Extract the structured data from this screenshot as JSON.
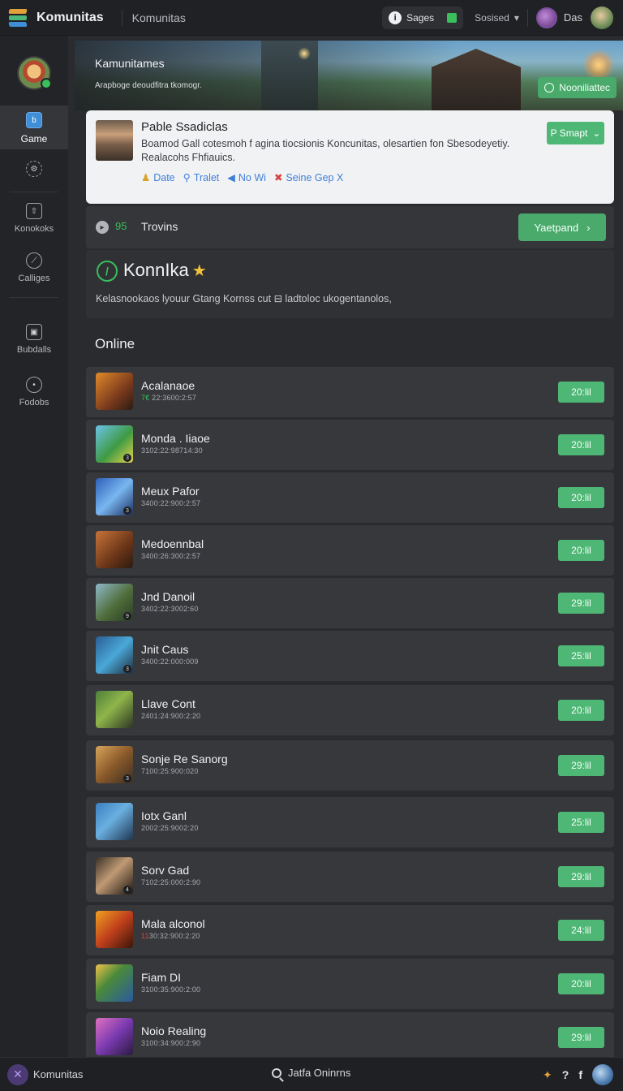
{
  "topbar": {
    "brand": "Komunitas",
    "breadcrumb": "Komunitas",
    "pill_label": "Sages",
    "dropdown_label": "Sosised",
    "username": "Das"
  },
  "sidebar": {
    "items": [
      {
        "label": "Game",
        "icon": "game-icon",
        "active": true
      },
      {
        "label": "",
        "icon": "gear-icon"
      },
      {
        "label": "Konokoks",
        "icon": "upload-icon"
      },
      {
        "label": "Calliges",
        "icon": "compass-icon"
      },
      {
        "label": "Bubdalls",
        "icon": "box-icon"
      },
      {
        "label": "Fodobs",
        "icon": "circle-icon"
      }
    ]
  },
  "hero": {
    "title": "Kamunitames",
    "subtitle": "Arapboge deoudfitra tkomogr.",
    "button": "Nooniliattec"
  },
  "card": {
    "title": "Pable Ssadiclas",
    "text": "Boamod Gall cotesmoh f agina tiocsionis Koncunitas, olesartien fon Sbesodeyetiy. Realacohs Fhfiauics.",
    "links": [
      "Date",
      "Tralet",
      "No Wi",
      "Seine Gep X"
    ],
    "button": "P Smapt"
  },
  "trovins": {
    "count": "95",
    "label": "Trovins",
    "button": "Yaetpand"
  },
  "konnika": {
    "title": "KonnIka",
    "desc": "Kelasnookaos lyouur Gtang Kornss cut ⊟ ladtoloc ukogentanolos,"
  },
  "online": {
    "heading": "Online",
    "rows": [
      {
        "name": "Acalanaoe",
        "meta": "7€ 22:3600:2:57",
        "btn": "20:lil",
        "hl": "green"
      },
      {
        "name": "Monda . Iiaoe",
        "meta": "3102:22:98714:30",
        "btn": "20:lil",
        "badge": "3"
      },
      {
        "name": "Meux Pafor",
        "meta": "3400:22:900:2:57",
        "btn": "20:lil",
        "badge": "3"
      },
      {
        "name": "Medoennbal",
        "meta": "3400:26:300:2:57",
        "btn": "20:lil"
      },
      {
        "name": "Jnd Danoil",
        "meta": "3402:22:3002:60",
        "btn": "29:lil",
        "badge": "9"
      },
      {
        "name": "Jnit Caus",
        "meta": "3400:22:000:009",
        "btn": "25:lil",
        "badge": "3"
      },
      {
        "name": "Llave Cont",
        "meta": "2401:24:900:2:20",
        "btn": "20:lil"
      },
      {
        "name": "Sonje Re Sanorg",
        "meta": "7100:25:900:020",
        "btn": "29:lil",
        "badge": "3"
      },
      {
        "name": "Iotx Ganl",
        "meta": "2002:25:9002:20",
        "btn": "25:lil"
      },
      {
        "name": "Sorv Gad",
        "meta": "7102:25:000:2:90",
        "btn": "29:lil",
        "badge": "4"
      },
      {
        "name": "Mala alconol",
        "meta": "1130:32:900:2:20",
        "btn": "24:lil",
        "hl": "red"
      },
      {
        "name": "Fiam DI",
        "meta": "3100:35:900:2:00",
        "btn": "20:lil"
      },
      {
        "name": "Noio Realing",
        "meta": "3100:34:900:2:90",
        "btn": "29:lil"
      }
    ]
  },
  "bottombar": {
    "title": "Komunitas",
    "search": "Jatfa Oninrns"
  },
  "colors": {
    "accent_green": "#4fb776",
    "panel": "#37383c",
    "background": "#2a2b2e"
  }
}
